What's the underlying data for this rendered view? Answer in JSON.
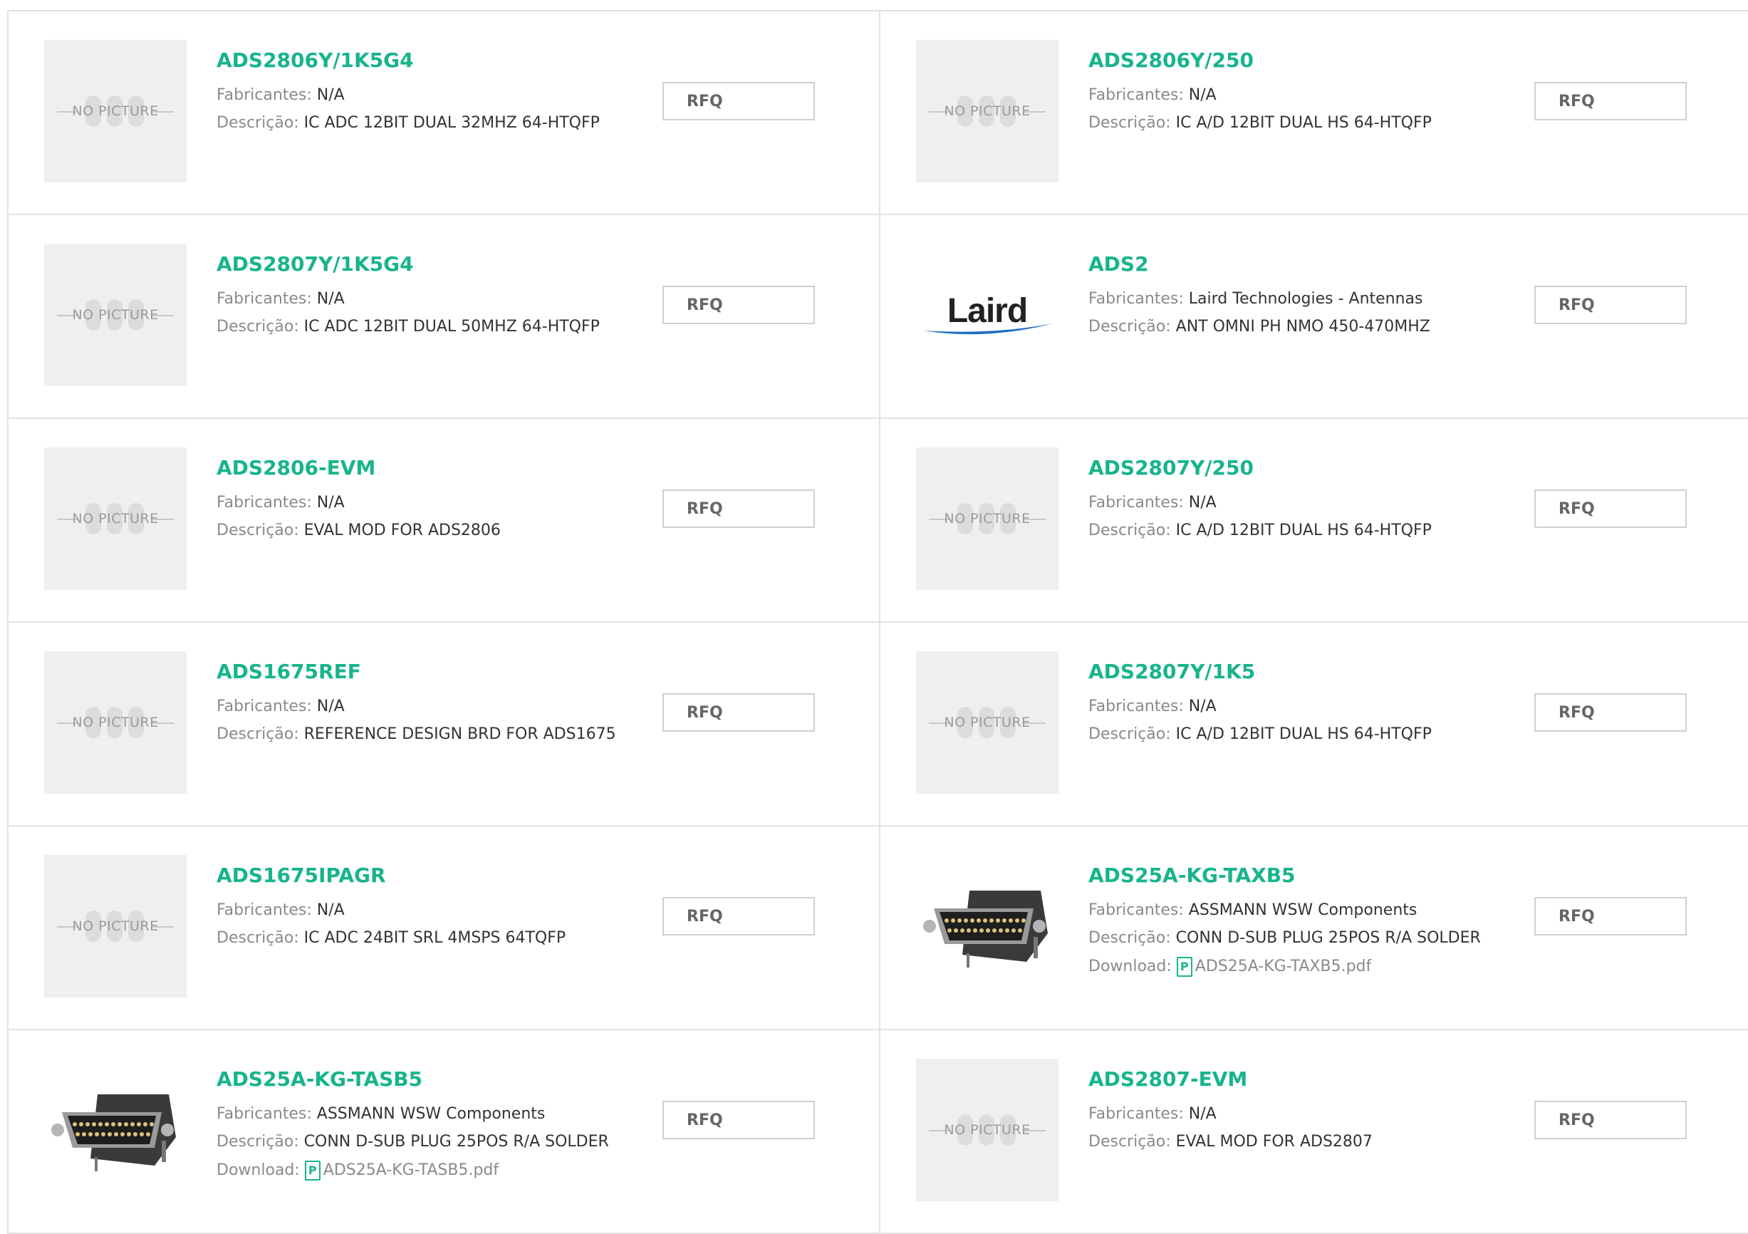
{
  "labels": {
    "manufacturer": "Fabricantes:",
    "description": "Descrição:",
    "download": "Download:",
    "no_picture": "NO PICTURE",
    "rfq": "RFQ",
    "pdf_icon": "P"
  },
  "colors": {
    "accent": "#18b48c",
    "border": "#e2e2e2",
    "placeholder_bg": "#efefef"
  },
  "products": [
    {
      "part": "ADS2806Y/1K5G4",
      "manufacturer": "N/A",
      "description": "IC ADC 12BIT DUAL 32MHZ 64-HTQFP",
      "image": "no-picture",
      "download": ""
    },
    {
      "part": "ADS2806Y/250",
      "manufacturer": "N/A",
      "description": "IC A/D 12BIT DUAL HS 64-HTQFP",
      "image": "no-picture",
      "download": ""
    },
    {
      "part": "ADS2807Y/1K5G4",
      "manufacturer": "N/A",
      "description": "IC ADC 12BIT DUAL 50MHZ 64-HTQFP",
      "image": "no-picture",
      "download": ""
    },
    {
      "part": "ADS2",
      "manufacturer": "Laird Technologies - Antennas",
      "description": "ANT OMNI PH NMO 450-470MHZ",
      "image": "laird-logo",
      "logo_text": "Laird",
      "download": ""
    },
    {
      "part": "ADS2806-EVM",
      "manufacturer": "N/A",
      "description": "EVAL MOD FOR ADS2806",
      "image": "no-picture",
      "download": ""
    },
    {
      "part": "ADS2807Y/250",
      "manufacturer": "N/A",
      "description": "IC A/D 12BIT DUAL HS 64-HTQFP",
      "image": "no-picture",
      "download": ""
    },
    {
      "part": "ADS1675REF",
      "manufacturer": "N/A",
      "description": "REFERENCE DESIGN BRD FOR ADS1675",
      "image": "no-picture",
      "download": ""
    },
    {
      "part": "ADS2807Y/1K5",
      "manufacturer": "N/A",
      "description": "IC A/D 12BIT DUAL HS 64-HTQFP",
      "image": "no-picture",
      "download": ""
    },
    {
      "part": "ADS1675IPAGR",
      "manufacturer": "N/A",
      "description": "IC ADC 24BIT SRL 4MSPS 64TQFP",
      "image": "no-picture",
      "download": ""
    },
    {
      "part": "ADS25A-KG-TAXB5",
      "manufacturer": "ASSMANN WSW Components",
      "description": "CONN D-SUB PLUG 25POS R/A SOLDER",
      "image": "dsub-photo",
      "download": "ADS25A-KG-TAXB5.pdf"
    },
    {
      "part": "ADS25A-KG-TASB5",
      "manufacturer": "ASSMANN WSW Components",
      "description": "CONN D-SUB PLUG 25POS R/A SOLDER",
      "image": "dsub-photo",
      "download": "ADS25A-KG-TASB5.pdf"
    },
    {
      "part": "ADS2807-EVM",
      "manufacturer": "N/A",
      "description": "EVAL MOD FOR ADS2807",
      "image": "no-picture",
      "download": ""
    }
  ]
}
